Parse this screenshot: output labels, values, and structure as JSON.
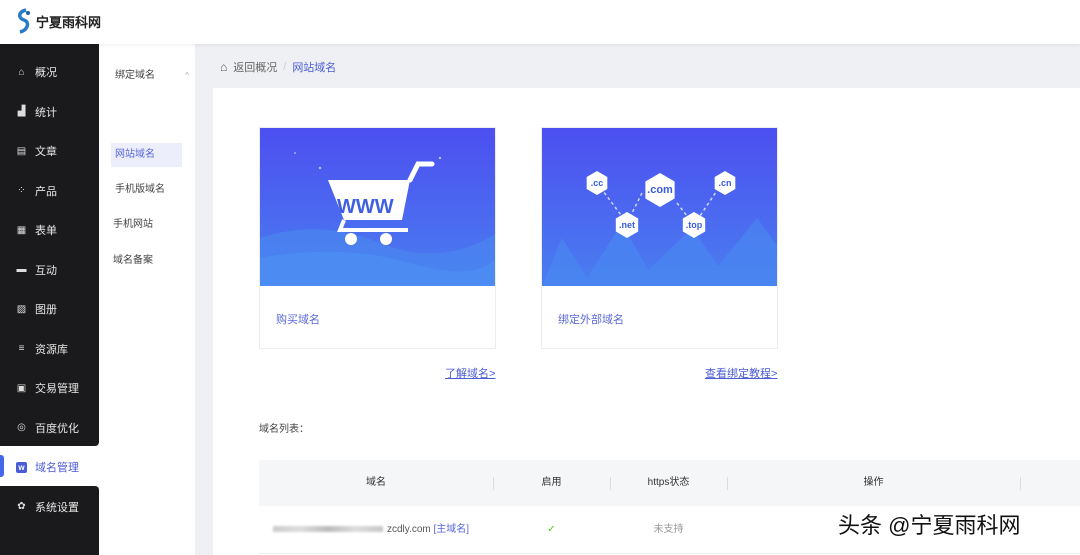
{
  "header": {
    "logo_text": "宁夏雨科网"
  },
  "nav": [
    {
      "label": "概况",
      "icon": "home-icon"
    },
    {
      "label": "统计",
      "icon": "chart-icon"
    },
    {
      "label": "文章",
      "icon": "article-icon"
    },
    {
      "label": "产品",
      "icon": "grid-icon"
    },
    {
      "label": "表单",
      "icon": "form-icon"
    },
    {
      "label": "互动",
      "icon": "chat-icon"
    },
    {
      "label": "图册",
      "icon": "album-icon"
    },
    {
      "label": "资源库",
      "icon": "database-icon"
    },
    {
      "label": "交易管理",
      "icon": "clipboard-icon"
    },
    {
      "label": "百度优化",
      "icon": "target-icon"
    },
    {
      "label": "域名管理",
      "icon": "domain-icon",
      "active": true
    },
    {
      "label": "系统设置",
      "icon": "gear-icon"
    }
  ],
  "subnav": {
    "group": "绑定域名",
    "items": [
      "网站域名",
      "手机版域名",
      "手机网站",
      "域名备案"
    ]
  },
  "breadcrumb": {
    "back": "返回概况",
    "sep": "/",
    "current": "网站域名"
  },
  "cards": [
    {
      "label": "购买域名",
      "link": "了解域名>",
      "art": "WWW"
    },
    {
      "label": "绑定外部域名",
      "link": "查看绑定教程>",
      "tlds": [
        ".cc",
        ".com",
        ".cn",
        ".net",
        ".top"
      ]
    }
  ],
  "list": {
    "title": "域名列表：",
    "columns": [
      "域名",
      "启用",
      "https状态",
      "操作"
    ],
    "rows": [
      {
        "domain": "zcdly.com",
        "tag": "[主域名]",
        "enabled": "✓",
        "https": "未支持"
      }
    ]
  },
  "watermark": "头条 @宁夏雨科网"
}
